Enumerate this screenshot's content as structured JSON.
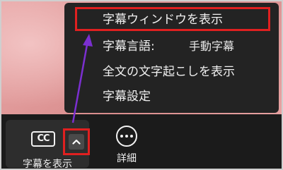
{
  "menu": {
    "items": [
      {
        "label": "字幕ウィンドウを表示"
      },
      {
        "label": "字幕言語:",
        "value": "手動字幕"
      },
      {
        "label": "全文の文字起こしを表示"
      },
      {
        "label": "字幕設定"
      }
    ]
  },
  "toolbar": {
    "cc_icon_text": "CC",
    "cc_label": "字幕を表示",
    "caret_icon": "chevron-up-icon",
    "more_icon": "more-horizontal-icon",
    "more_label": "詳細"
  },
  "colors": {
    "highlight": "#e02020",
    "annotation_arrow": "#7b2fd0",
    "menu_bg": "#232323",
    "toolbar_bg": "#1b1b1b"
  }
}
